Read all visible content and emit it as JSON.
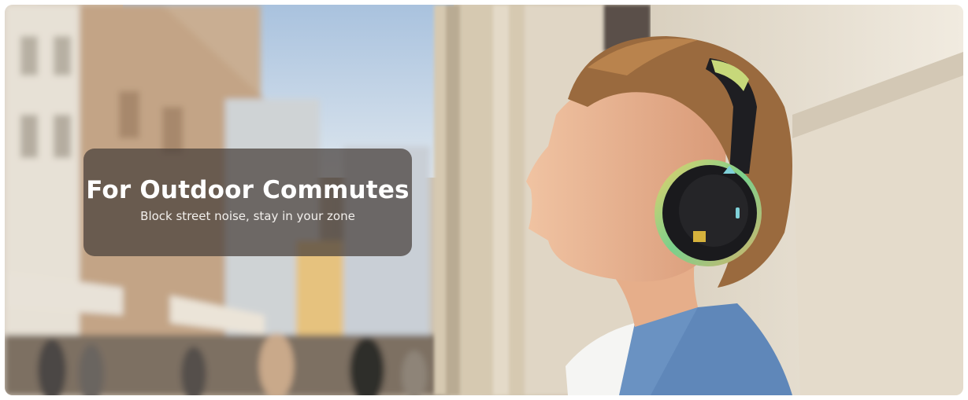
{
  "banner": {
    "title": "For Outdoor Commutes",
    "subtitle": "Block street noise, stay in your zone",
    "image_subject": "man-with-headphones-street-photo"
  },
  "colors": {
    "caption_bg": "#463e3a",
    "caption_text": "#ffffff",
    "sky": "#b9cde3",
    "wall": "#ece4d6",
    "jacket": "#5e86b8",
    "headphones": "#1c1c1e"
  }
}
